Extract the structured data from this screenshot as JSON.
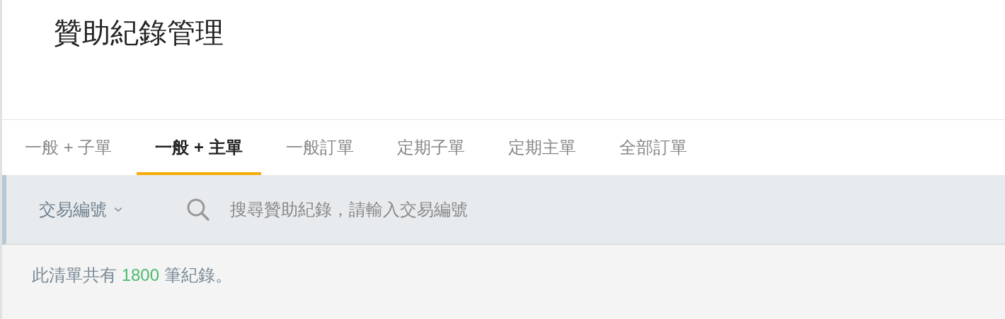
{
  "page": {
    "title": "贊助紀錄管理"
  },
  "tabs": [
    {
      "label": "一般 + 子單",
      "selected": false
    },
    {
      "label": "一般 + 主單",
      "selected": true
    },
    {
      "label": "一般訂單",
      "selected": false
    },
    {
      "label": "定期子單",
      "selected": false
    },
    {
      "label": "定期主單",
      "selected": false
    },
    {
      "label": "全部訂單",
      "selected": false
    }
  ],
  "search": {
    "field_selector": "交易編號",
    "placeholder": "搜尋贊助紀錄，請輸入交易編號"
  },
  "summary": {
    "prefix": "此清單共有",
    "count": "1800",
    "suffix": "筆紀錄。"
  }
}
